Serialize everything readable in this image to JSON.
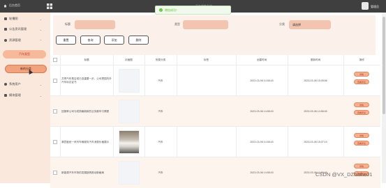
{
  "topbar": {
    "home_label": "后台首页",
    "title": "汽车销售系统",
    "username": "管理员"
  },
  "toast": {
    "message": "增加成功！"
  },
  "sidebar": {
    "items": [
      {
        "label": "轮播图",
        "icon": "image-icon"
      },
      {
        "label": "公告资讯管理",
        "icon": "notice-icon"
      },
      {
        "label": "资源管理",
        "icon": "location-icon"
      }
    ],
    "subitems": [
      {
        "label": "汽车类型"
      },
      {
        "label": "新的分类"
      }
    ],
    "items_bottom": [
      {
        "label": "系统用户",
        "icon": "user-icon"
      },
      {
        "label": "模块管理",
        "icon": "module-icon"
      }
    ]
  },
  "search": {
    "title_label": "标题",
    "category_label": "类型",
    "type_label": "分类",
    "type_value": "请选择"
  },
  "actions": {
    "reset": "重置",
    "query": "查询",
    "add": "添加",
    "delete": "删除"
  },
  "table": {
    "headers": [
      "标题",
      "封面图",
      "所属分类",
      "标签",
      "创建时间",
      "更新时间",
      "操作"
    ],
    "rows": [
      {
        "title": "共享汽车是否或已选重要一步，公司把国内外汽车标志证书",
        "category": "汽车",
        "created": "2023-03-06 14:55:43",
        "updated": "2023-03-06 15:05:56",
        "has_image": false
      },
      {
        "title": "回报率公司与成熟最新款的业务都车行情更",
        "category": "汽车",
        "created": "2023-03-06 14:55:43",
        "updated": "2023-03-06 14:55:45",
        "has_image": false
      },
      {
        "title": "满意度统一系列车辆服务汽车消费价格展示",
        "category": "汽车",
        "created": "2023-03-06 14:55:43",
        "updated": "2023-03-06 15:07:19",
        "has_image": true
      },
      {
        "title": "新能源汽车市场的发展趋势推动新格局",
        "category": "汽车",
        "created": "2023-03-06 14:55:43",
        "updated": "2023-03-06 14:55:45",
        "has_image": false
      }
    ],
    "edit_label": "详情",
    "comment_label": "查看评论"
  },
  "watermark": "CSDN @VX_DZbishe01"
}
